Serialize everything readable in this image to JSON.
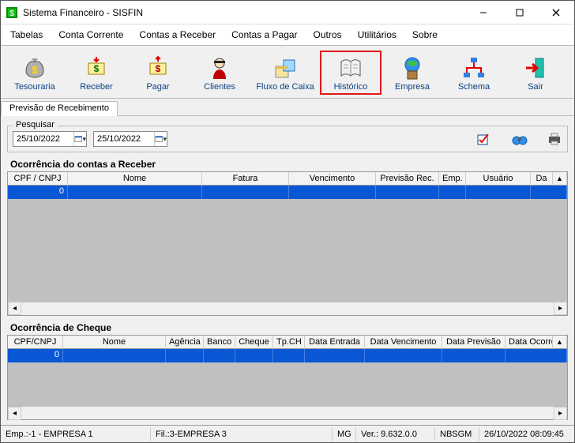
{
  "window": {
    "title": "Sistema Financeiro - SISFIN"
  },
  "menu": [
    "Tabelas",
    "Conta Corrente",
    "Contas a Receber",
    "Contas a Pagar",
    "Outros",
    "Utilitários",
    "Sobre"
  ],
  "toolbar": [
    {
      "label": "Tesouraria",
      "icon": "money-bag-icon"
    },
    {
      "label": "Receber",
      "icon": "receive-money-icon"
    },
    {
      "label": "Pagar",
      "icon": "pay-money-icon"
    },
    {
      "label": "Clientes",
      "icon": "clients-icon"
    },
    {
      "label": "Fluxo de Caixa",
      "icon": "cashflow-icon"
    },
    {
      "label": "Histórico",
      "icon": "history-book-icon",
      "highlighted": true
    },
    {
      "label": "Empresa",
      "icon": "company-globe-icon"
    },
    {
      "label": "Schema",
      "icon": "schema-icon"
    },
    {
      "label": "Sair",
      "icon": "exit-icon"
    }
  ],
  "tabs": [
    {
      "label": "Previsão de Recebimento"
    }
  ],
  "search": {
    "legend": "Pesquisar",
    "date_from": "25/10/2022",
    "date_to": "25/10/2022"
  },
  "grid1": {
    "title": "Ocorrência do contas a Receber",
    "columns": [
      "CPF / CNPJ",
      "Nome",
      "Fatura",
      "Vencimento",
      "Previsão Rec.",
      "Emp.",
      "Usuário",
      "Da"
    ],
    "row0": {
      "cpf": "0"
    }
  },
  "grid2": {
    "title": "Ocorrência de Cheque",
    "columns": [
      "CPF/CNPJ",
      "Nome",
      "Agência",
      "Banco",
      "Cheque",
      "Tp.CH",
      "Data Entrada",
      "Data Vencimento",
      "Data Previsão",
      "Data Ocorrê"
    ],
    "row0": {
      "cpf": "0"
    }
  },
  "status": {
    "emp": "Emp.:-1 - EMPRESA 1",
    "fil": "Fil.:3-EMPRESA 3",
    "uf": "MG",
    "ver": "Ver.: 9.632.0.0",
    "user": "NBSGM",
    "datetime": "26/10/2022 08:09:45"
  }
}
